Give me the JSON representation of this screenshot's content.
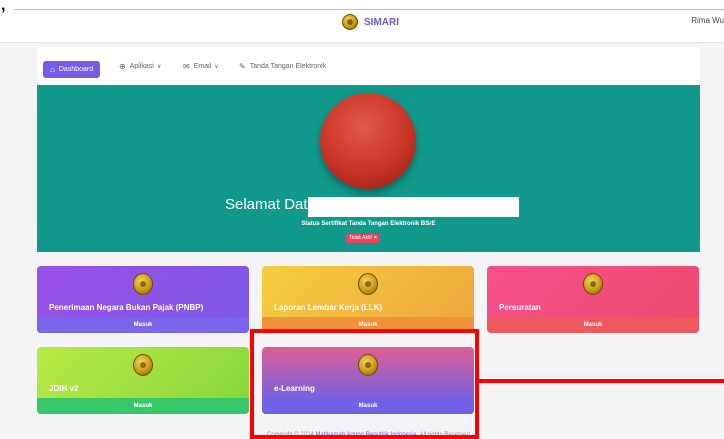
{
  "header": {
    "app_name": "SIMARI",
    "user_name": "Rima Wu",
    "corner_mark": ","
  },
  "nav": {
    "items": [
      {
        "label": "Dashboard",
        "icon": "home-icon"
      },
      {
        "label": "Aplikasi",
        "icon": "box-icon"
      },
      {
        "label": "Email",
        "icon": "mail-icon"
      },
      {
        "label": "Tanda Tangan Elektronik",
        "icon": "pen-icon"
      }
    ]
  },
  "hero": {
    "welcome": "Selamat Datang,",
    "cert_status": "Status Sertifikat Tanda Tangan Elektronik BSrE",
    "badge": "Tidak Aktif ✕"
  },
  "cards": [
    {
      "title": "Penerimaan Negara Bukan Pajak (PNBP)",
      "action": "Masuk"
    },
    {
      "title": "Laporan Lembar Kerja (LLK)",
      "action": "Masuk"
    },
    {
      "title": "Persuratan",
      "action": "Masuk"
    },
    {
      "title": "JDIH v2",
      "action": "Masuk"
    },
    {
      "title": "e-Learning",
      "action": "Masuk"
    }
  ],
  "footer": {
    "prefix": "Copyright © 2024 ",
    "org": "Mahkamah Agung Republik Indonesia",
    "suffix": ". All rights Reserved"
  },
  "colors": {
    "accent": "#7a5ae8",
    "hero": "#119a8b",
    "highlight": "#ff0000"
  }
}
